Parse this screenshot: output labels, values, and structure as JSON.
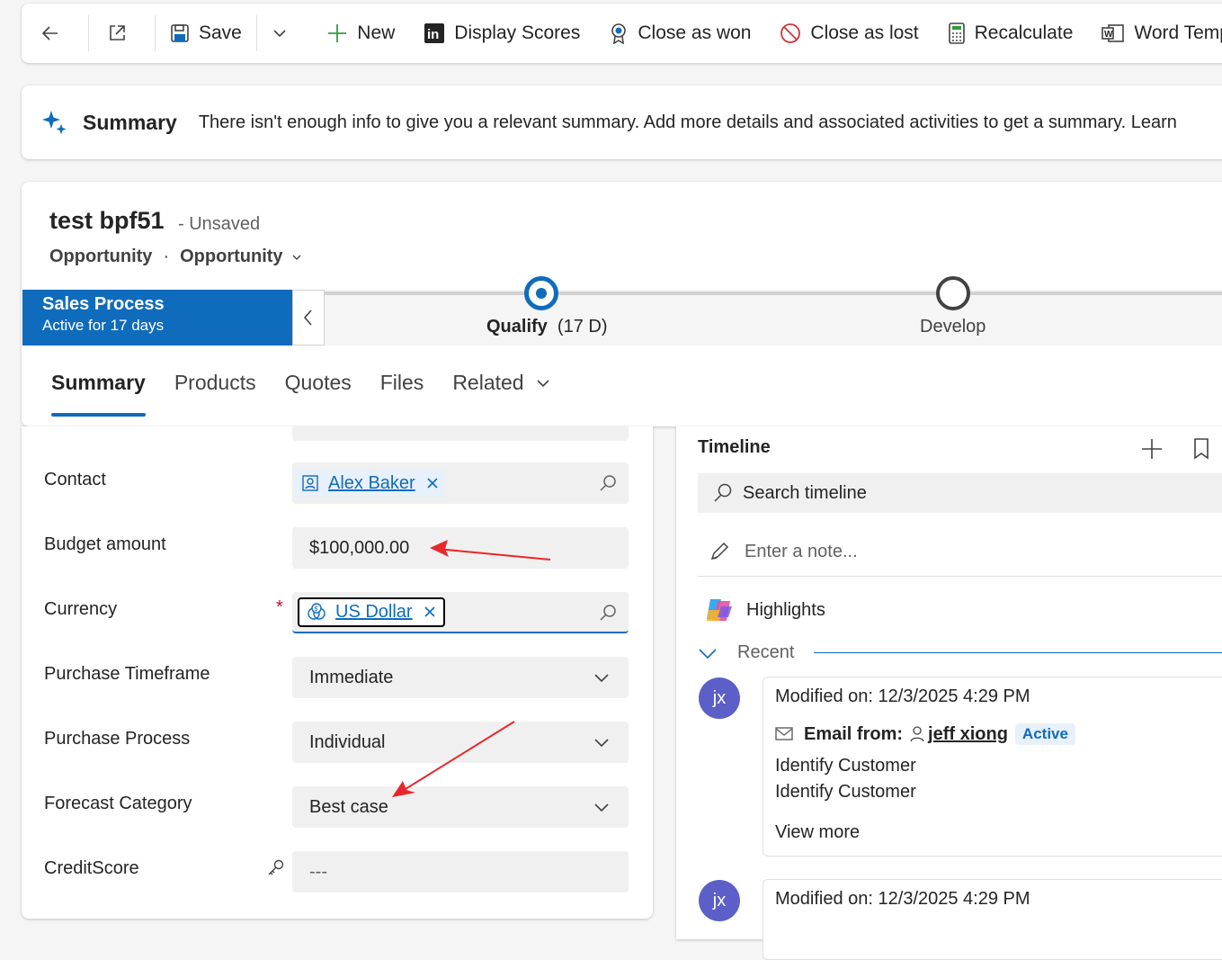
{
  "toolbar": {
    "save": "Save",
    "new": "New",
    "display_scores": "Display Scores",
    "close_won": "Close as won",
    "close_lost": "Close as lost",
    "recalculate": "Recalculate",
    "word_templates": "Word Temp"
  },
  "summary": {
    "title": "Summary",
    "text": "There isn't enough info to give you a relevant summary. Add more details and associated activities to get a summary. Learn"
  },
  "record": {
    "title": "test bpf51",
    "unsaved": "- Unsaved",
    "entity": "Opportunity",
    "form": "Opportunity"
  },
  "bpf": {
    "process_name": "Sales Process",
    "active_for": "Active for 17 days",
    "stages": [
      {
        "label": "Qualify",
        "duration": "(17 D)"
      },
      {
        "label": "Develop"
      }
    ]
  },
  "tabs": [
    "Summary",
    "Products",
    "Quotes",
    "Files",
    "Related"
  ],
  "form": {
    "contact": {
      "label": "Contact",
      "value": "Alex Baker"
    },
    "budget": {
      "label": "Budget amount",
      "value": "$100,000.00"
    },
    "currency": {
      "label": "Currency",
      "value": "US Dollar",
      "required": "*"
    },
    "timeframe": {
      "label": "Purchase Timeframe",
      "value": "Immediate"
    },
    "process": {
      "label": "Purchase Process",
      "value": "Individual"
    },
    "forecast": {
      "label": "Forecast Category",
      "value": "Best case"
    },
    "creditscore": {
      "label": "CreditScore",
      "value": "---"
    }
  },
  "timeline": {
    "title": "Timeline",
    "search_placeholder": "Search timeline",
    "note_placeholder": "Enter a note...",
    "highlights": "Highlights",
    "recent": "Recent",
    "entries": [
      {
        "avatar": "jx",
        "modified": "Modified on: 12/3/2025 4:29 PM",
        "email_label": "Email from:",
        "sender": "jeff xiong",
        "status": "Active",
        "line1": "Identify Customer",
        "line2": "Identify Customer",
        "view_more": "View more"
      },
      {
        "avatar": "jx",
        "modified": "Modified on: 12/3/2025 4:29 PM"
      }
    ]
  },
  "colors": {
    "brand": "#0f6cbd",
    "annotation": "#e8262b",
    "avatar": "#5b5fc7"
  }
}
